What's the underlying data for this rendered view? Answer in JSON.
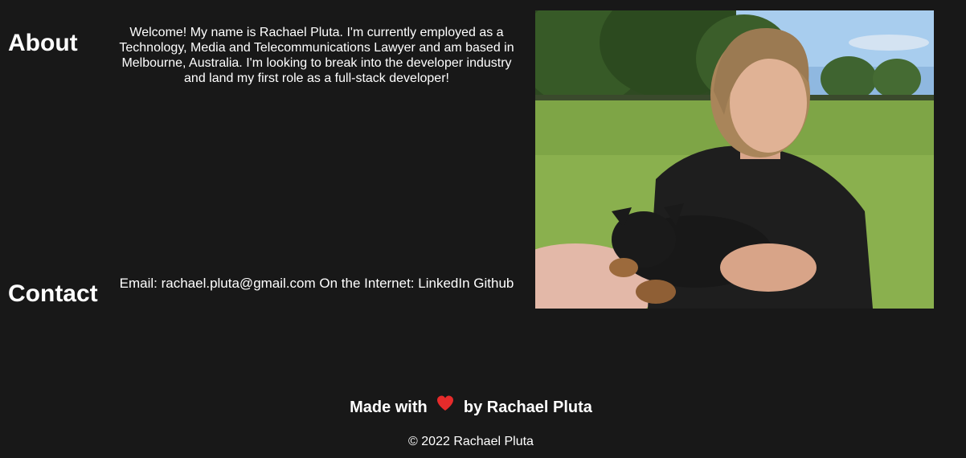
{
  "about": {
    "heading": "About",
    "text": "Welcome! My name is Rachael Pluta. I'm currently employed as a Technology, Media and Telecommunications Lawyer and am based in Melbourne, Australia. I'm looking to break into the developer industry and land my first role as a full-stack developer!"
  },
  "contact": {
    "heading": "Contact",
    "email_prefix": "Email: ",
    "email": "rachael.pluta@gmail.com",
    "internet_prefix": "On the Internet: ",
    "linkedin": "LinkedIn",
    "github": "Github"
  },
  "footer": {
    "made_with": "Made with",
    "by": "by Rachael Pluta",
    "heart_icon": "heart-icon",
    "heart_color": "#e62b2b",
    "copyright": "© 2022 Rachael Pluta"
  },
  "colors": {
    "background": "#181818",
    "text": "#ffffff"
  }
}
